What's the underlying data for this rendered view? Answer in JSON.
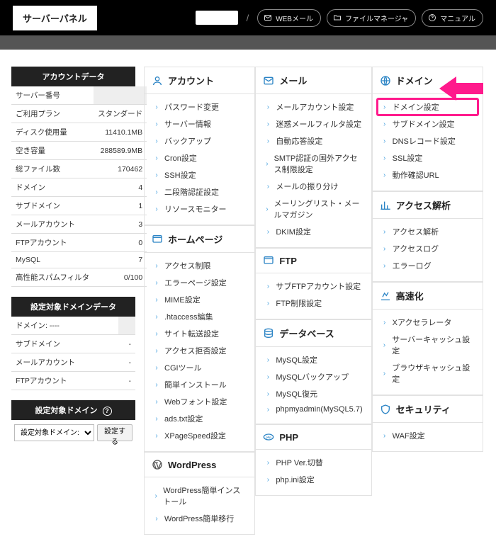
{
  "topbar": {
    "logo": "サーバーパネル",
    "links": {
      "webmail": "WEBメール",
      "filemanager": "ファイルマネージャ",
      "manual": "マニュアル"
    }
  },
  "sidebar": {
    "account_head": "アカウントデータ",
    "account_rows": [
      {
        "label": "サーバー番号",
        "value": ""
      },
      {
        "label": "ご利用プラン",
        "value": "スタンダード"
      },
      {
        "label": "ディスク使用量",
        "value": "11410.1MB"
      },
      {
        "label": "空き容量",
        "value": "288589.9MB"
      },
      {
        "label": "総ファイル数",
        "value": "170462"
      },
      {
        "label": "ドメイン",
        "value": "4"
      },
      {
        "label": "サブドメイン",
        "value": "1"
      },
      {
        "label": "メールアカウント",
        "value": "3"
      },
      {
        "label": "FTPアカウント",
        "value": "0"
      },
      {
        "label": "MySQL",
        "value": "7"
      },
      {
        "label": "高性能スパムフィルタ",
        "value": "0/100"
      }
    ],
    "target_head": "設定対象ドメインデータ",
    "target_rows": [
      {
        "label": "ドメイン:  ----",
        "value": ""
      },
      {
        "label": "サブドメイン",
        "value": "-"
      },
      {
        "label": "メールアカウント",
        "value": "-"
      },
      {
        "label": "FTPアカウント",
        "value": "-"
      }
    ],
    "select_head": "設定対象ドメイン",
    "select_placeholder": "設定対象ドメイン:",
    "select_btn": "設定する"
  },
  "panels": {
    "account": {
      "title": "アカウント",
      "items": [
        "パスワード変更",
        "サーバー情報",
        "バックアップ",
        "Cron設定",
        "SSH設定",
        "二段階認証設定",
        "リソースモニター"
      ]
    },
    "mail": {
      "title": "メール",
      "items": [
        "メールアカウント設定",
        "迷惑メールフィルタ設定",
        "自動応答設定",
        "SMTP認証の国外アクセス制限設定",
        "メールの振り分け",
        "メーリングリスト・メールマガジン",
        "DKIM設定"
      ]
    },
    "domain": {
      "title": "ドメイン",
      "items": [
        "ドメイン設定",
        "サブドメイン設定",
        "DNSレコード設定",
        "SSL設定",
        "動作確認URL"
      ],
      "highlight_index": 0
    },
    "homepage": {
      "title": "ホームページ",
      "items": [
        "アクセス制限",
        "エラーページ設定",
        "MIME設定",
        ".htaccess編集",
        "サイト転送設定",
        "アクセス拒否設定",
        "CGIツール",
        "簡単インストール",
        "Webフォント設定",
        "ads.txt設定",
        "XPageSpeed設定"
      ]
    },
    "ftp": {
      "title": "FTP",
      "items": [
        "サブFTPアカウント設定",
        "FTP制限設定"
      ]
    },
    "access": {
      "title": "アクセス解析",
      "items": [
        "アクセス解析",
        "アクセスログ",
        "エラーログ"
      ]
    },
    "db": {
      "title": "データベース",
      "items": [
        "MySQL設定",
        "MySQLバックアップ",
        "MySQL復元",
        "phpmyadmin(MySQL5.7)"
      ]
    },
    "speed": {
      "title": "高速化",
      "items": [
        "Xアクセラレータ",
        "サーバーキャッシュ設定",
        "ブラウザキャッシュ設定"
      ]
    },
    "php": {
      "title": "PHP",
      "items": [
        "PHP Ver.切替",
        "php.ini設定"
      ]
    },
    "security": {
      "title": "セキュリティ",
      "items": [
        "WAF設定"
      ]
    },
    "wordpress": {
      "title": "WordPress",
      "items": [
        "WordPress簡単インストール",
        "WordPress簡単移行"
      ]
    }
  }
}
